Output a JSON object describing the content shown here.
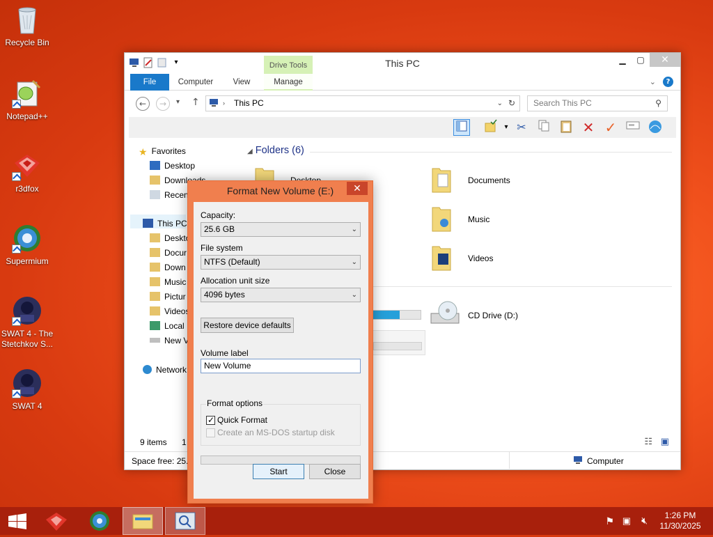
{
  "desktop": {
    "icons": [
      {
        "label": "Recycle Bin"
      },
      {
        "label": "Notepad++"
      },
      {
        "label": "r3dfox"
      },
      {
        "label": "Supermium"
      },
      {
        "label": "SWAT 4 - The Stetchkov S..."
      },
      {
        "label": "SWAT 4"
      }
    ]
  },
  "explorer": {
    "title": "This PC",
    "drive_tools": "Drive Tools",
    "tabs": {
      "file": "File",
      "computer": "Computer",
      "view": "View",
      "manage": "Manage"
    },
    "address": "This PC",
    "search_placeholder": "Search This PC",
    "nav": {
      "favorites": "Favorites",
      "desktop": "Desktop",
      "downloads": "Downloads",
      "recent": "Recen",
      "this_pc": "This PC",
      "pc_desktop": "Deskto",
      "pc_documents": "Docur",
      "pc_downloads": "Down",
      "pc_music": "Music",
      "pc_pictures": "Pictur",
      "pc_videos": "Videos",
      "pc_local": "Local",
      "pc_new": "New V",
      "network": "Network"
    },
    "folders_header": "Folders (6)",
    "folders": {
      "desktop": "Desktop",
      "documents": "Documents",
      "music": "Music",
      "videos": "Videos"
    },
    "devices": {
      "cd_drive": "CD Drive (D:)"
    },
    "local_disk_used_fraction": 0.6,
    "status": {
      "items": "9 items",
      "selected": "1"
    },
    "space_free": "Space free: 25.5",
    "computer_label": "Computer"
  },
  "dialog": {
    "title": "Format New Volume (E:)",
    "capacity_label": "Capacity:",
    "capacity_value": "25.6 GB",
    "filesystem_label": "File system",
    "filesystem_value": "NTFS (Default)",
    "allocation_label": "Allocation unit size",
    "allocation_value": "4096 bytes",
    "restore_button": "Restore device defaults",
    "volume_label_label": "Volume label",
    "volume_label_value": "New Volume",
    "format_options_label": "Format options",
    "quick_format_label": "Quick Format",
    "quick_format_checked": true,
    "msdos_label": "Create an MS-DOS startup disk",
    "msdos_checked": false,
    "progress_fraction": 0,
    "start_button": "Start",
    "close_button": "Close"
  },
  "taskbar": {
    "time": "1:26 PM",
    "date": "11/30/2025"
  },
  "colors": {
    "accent_blue": "#1979ca",
    "taskbar": "#a8200c",
    "dialog_frame": "#f07f4e",
    "drive_tools": "#d6f1b6"
  }
}
